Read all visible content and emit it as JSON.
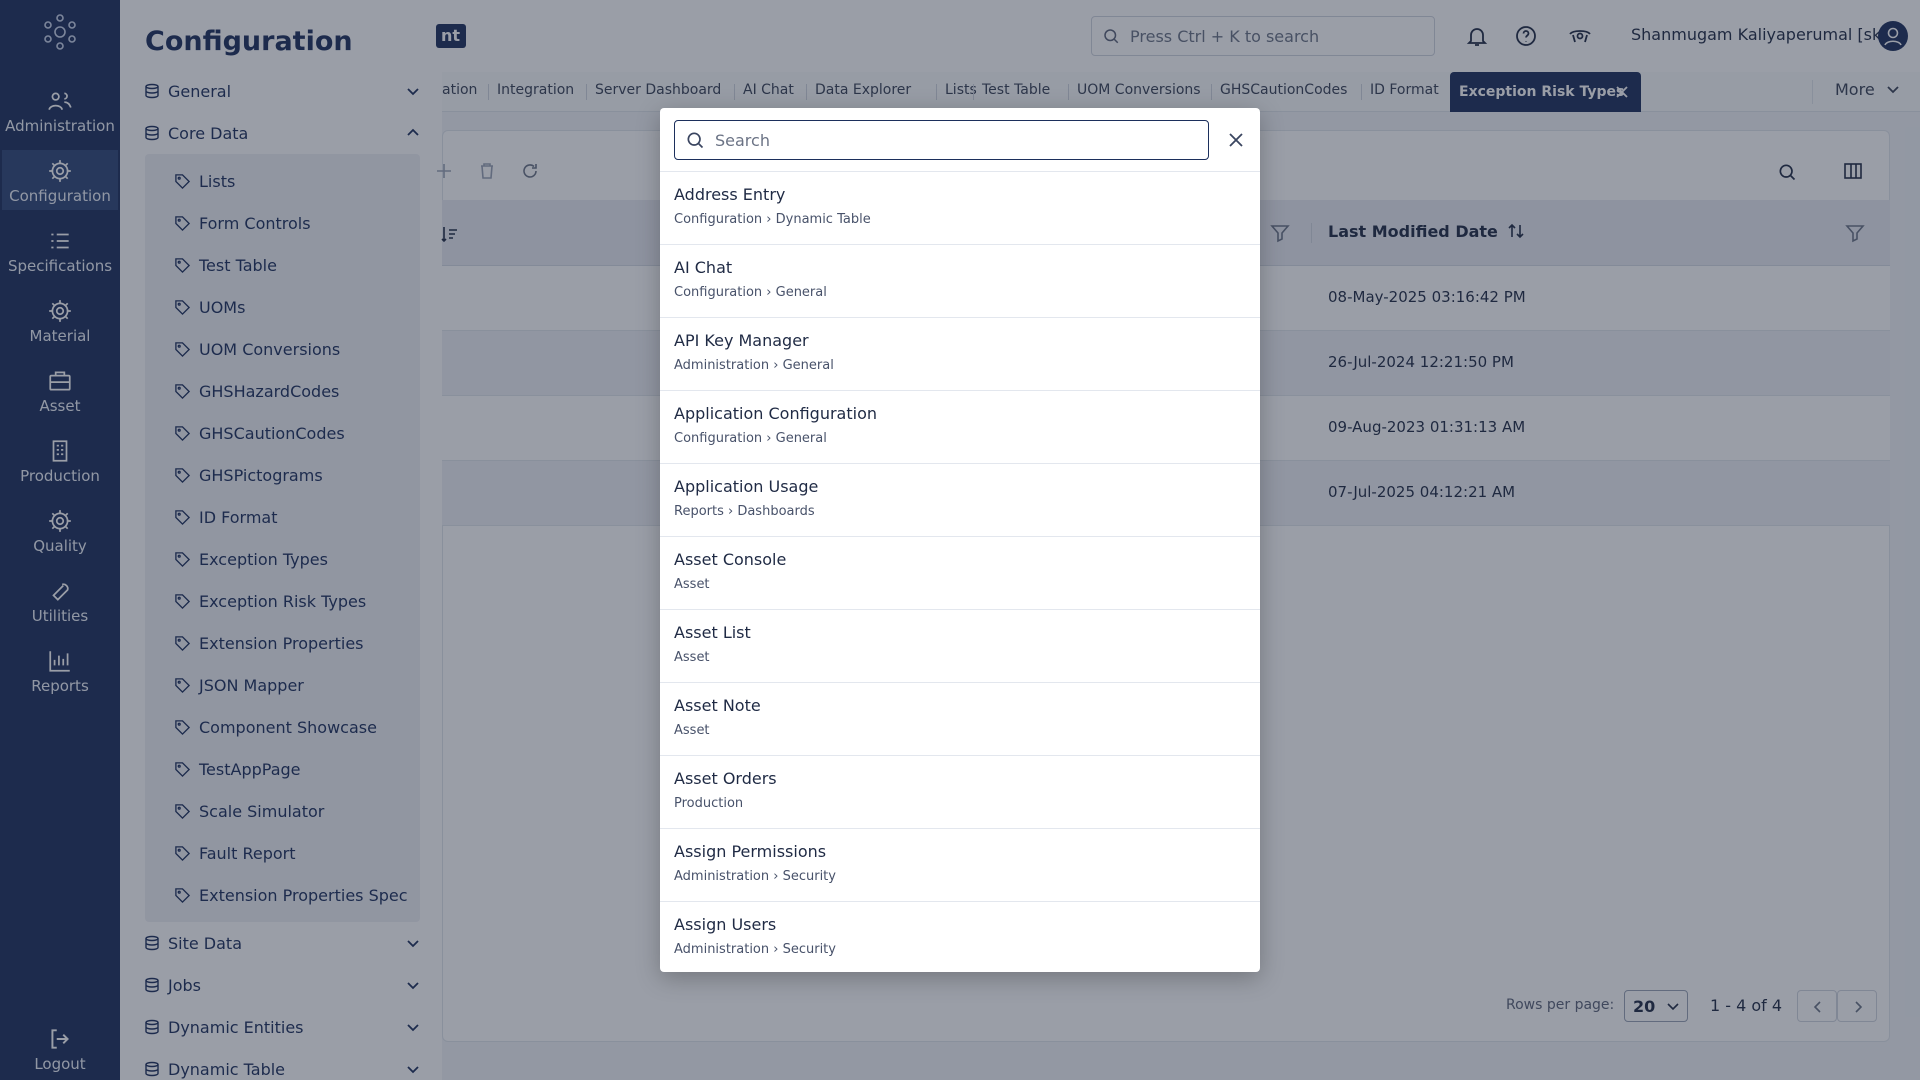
{
  "rail": {
    "items": [
      {
        "label": "Administration",
        "icon": "users-icon"
      },
      {
        "label": "Configuration",
        "icon": "gear-icon"
      },
      {
        "label": "Specifications",
        "icon": "list-icon"
      },
      {
        "label": "Material",
        "icon": "gear-icon"
      },
      {
        "label": "Asset",
        "icon": "briefcase-icon"
      },
      {
        "label": "Production",
        "icon": "building-icon"
      },
      {
        "label": "Quality",
        "icon": "gear-icon"
      },
      {
        "label": "Utilities",
        "icon": "wrench-icon"
      },
      {
        "label": "Reports",
        "icon": "bar-chart-icon"
      }
    ],
    "logout": "Logout"
  },
  "drawer": {
    "title": "Configuration",
    "groups_top": [
      "General",
      "Core Data"
    ],
    "core_items": [
      "Lists",
      "Form Controls",
      "Test Table",
      "UOMs",
      "UOM Conversions",
      "GHSHazardCodes",
      "GHSCautionCodes",
      "GHSPictograms",
      "ID Format",
      "Exception Types",
      "Exception Risk Types",
      "Extension Properties",
      "JSON Mapper",
      "Component Showcase",
      "TestAppPage",
      "Scale Simulator",
      "Fault Report",
      "Extension Properties Spec"
    ],
    "groups_bottom": [
      "Site Data",
      "Jobs",
      "Dynamic Entities",
      "Dynamic Table"
    ]
  },
  "header": {
    "brand_fragment": "nt",
    "search_placeholder": "Press Ctrl + K to search",
    "user_name": "Shanmugam Kaliyaperumal [sk]"
  },
  "tabs": {
    "items": [
      "ation",
      "Integration",
      "Server Dashboard",
      "AI Chat",
      "Data Explorer",
      "Lists",
      "Test Table",
      "UOM Conversions",
      "GHSCautionCodes",
      "ID Format"
    ],
    "active": "Exception Risk Types",
    "more": "More"
  },
  "table": {
    "column_title": "Last Modified Date",
    "dates": [
      "08-May-2025 03:16:42 PM",
      "26-Jul-2024 12:21:50 PM",
      "09-Aug-2023 01:31:13 AM",
      "07-Jul-2025 04:12:21 AM"
    ]
  },
  "pager": {
    "label": "Rows per page:",
    "per_page": "20",
    "count": "1 - 4 of 4"
  },
  "modal": {
    "placeholder": "Search",
    "results": [
      {
        "title": "Address Entry",
        "path": "Configuration › Dynamic Table"
      },
      {
        "title": "AI Chat",
        "path": "Configuration › General"
      },
      {
        "title": "API Key Manager",
        "path": "Administration › General"
      },
      {
        "title": "Application Configuration",
        "path": "Configuration › General"
      },
      {
        "title": "Application Usage",
        "path": "Reports › Dashboards"
      },
      {
        "title": "Asset Console",
        "path": "Asset"
      },
      {
        "title": "Asset List",
        "path": "Asset"
      },
      {
        "title": "Asset Note",
        "path": "Asset"
      },
      {
        "title": "Asset Orders",
        "path": "Production"
      },
      {
        "title": "Assign Permissions",
        "path": "Administration › Security"
      },
      {
        "title": "Assign Users",
        "path": "Administration › Security"
      }
    ]
  },
  "colors": {
    "navy": "#1c2f5c",
    "overlay": "rgba(30,40,60,0.45)"
  }
}
